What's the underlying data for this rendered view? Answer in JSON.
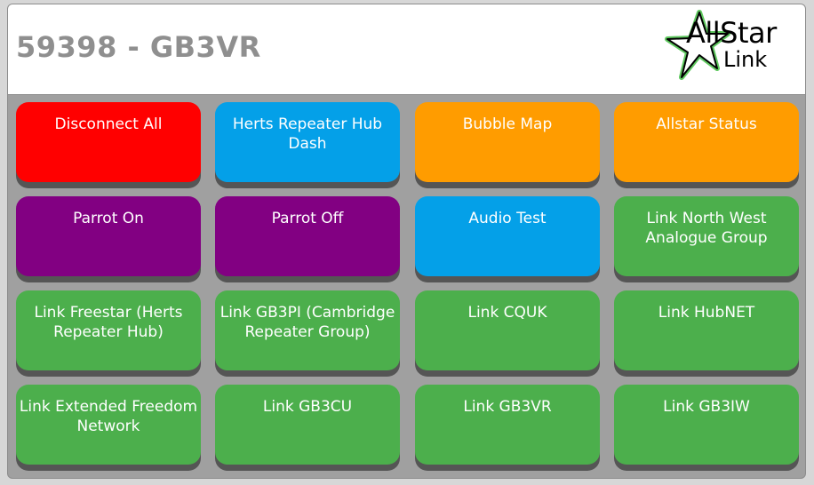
{
  "header": {
    "title": "59398 - GB3VR",
    "logo": {
      "line1": "AllStar",
      "line2": "Link",
      "icon": "star-icon",
      "star_color": "#000000",
      "star_outline_color": "#5fc85f"
    }
  },
  "colors": {
    "red": "#ff0000",
    "blue": "#04a0e8",
    "orange": "#ff9c00",
    "purple": "#820082",
    "green": "#4caf4c"
  },
  "buttons": [
    {
      "label": "Disconnect All",
      "color": "red"
    },
    {
      "label": "Herts Repeater Hub Dash",
      "color": "blue"
    },
    {
      "label": "Bubble Map",
      "color": "orange"
    },
    {
      "label": "Allstar Status",
      "color": "orange"
    },
    {
      "label": "Parrot On",
      "color": "purple"
    },
    {
      "label": "Parrot Off",
      "color": "purple"
    },
    {
      "label": "Audio Test",
      "color": "blue"
    },
    {
      "label": "Link North West Analogue Group",
      "color": "green"
    },
    {
      "label": "Link Freestar (Herts Repeater Hub)",
      "color": "green"
    },
    {
      "label": "Link GB3PI (Cambridge Repeater Group)",
      "color": "green"
    },
    {
      "label": "Link CQUK",
      "color": "green"
    },
    {
      "label": "Link HubNET",
      "color": "green"
    },
    {
      "label": "Link Extended Freedom Network",
      "color": "green"
    },
    {
      "label": "Link GB3CU",
      "color": "green"
    },
    {
      "label": "Link GB3VR",
      "color": "green"
    },
    {
      "label": "Link GB3IW",
      "color": "green"
    }
  ]
}
